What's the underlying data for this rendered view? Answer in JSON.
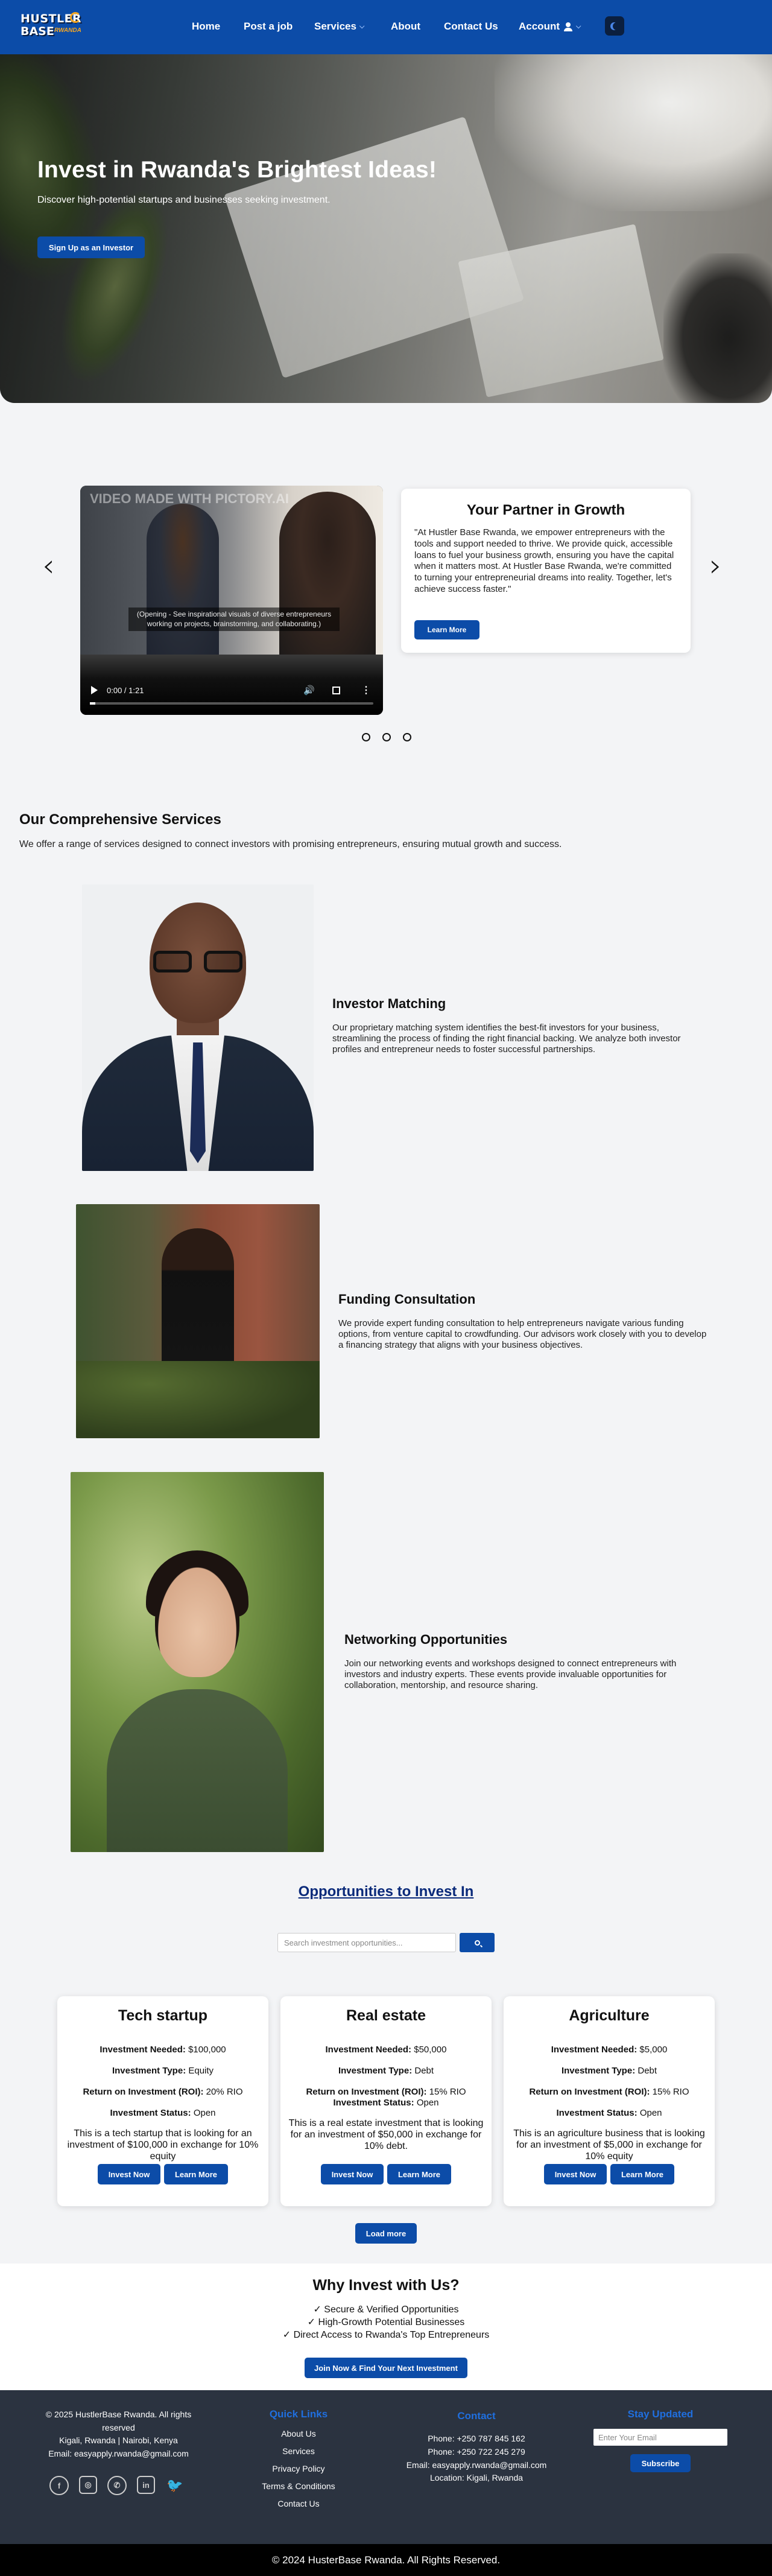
{
  "brand": {
    "logo_line1": "HUSTLER",
    "logo_line2": "BASE",
    "logo_tag": "RWANDA"
  },
  "nav": {
    "home": "Home",
    "post_job": "Post a job",
    "services": "Services",
    "about": "About",
    "contact": "Contact Us",
    "account": "Account"
  },
  "hero": {
    "title": "Invest in Rwanda's Brightest Ideas!",
    "subtitle": "Discover high-potential startups and businesses seeking investment.",
    "cta": "Sign Up as an Investor"
  },
  "video": {
    "watermark": "VIDEO MADE WITH PICTORY.AI",
    "caption": "(Opening - See inspirational visuals of diverse entrepreneurs working on projects, brainstorming, and collaborating.)",
    "time": "0:00 / 1:21",
    "progress": 0.02
  },
  "partner": {
    "title": "Your Partner in Growth",
    "text": "\"At Hustler Base Rwanda, we empower entrepreneurs with the tools and support needed to thrive. We provide quick, accessible loans to fuel your business growth, ensuring you have the capital when it matters most. At Hustler Base Rwanda, we're committed to turning your entrepreneurial dreams into reality. Together, let's achieve success faster.\"",
    "button": "Learn More"
  },
  "services": {
    "title": "Our Comprehensive Services",
    "subtitle": "We offer a range of services designed to connect investors with promising entrepreneurs, ensuring mutual growth and success.",
    "items": [
      {
        "title": "Investor Matching",
        "text": "Our proprietary matching system identifies the best-fit investors for your business, streamlining the process of finding the right financial backing. We analyze both investor profiles and entrepreneur needs to foster successful partnerships."
      },
      {
        "title": "Funding Consultation",
        "text": "We provide expert funding consultation to help entrepreneurs navigate various funding options, from venture capital to crowdfunding. Our advisors work closely with you to develop a financing strategy that aligns with your business objectives."
      },
      {
        "title": "Networking Opportunities",
        "text": "Join our networking events and workshops designed to connect entrepreneurs with investors and industry experts. These events provide invaluable opportunities for collaboration, mentorship, and resource sharing."
      }
    ]
  },
  "opportunities": {
    "title": "Opportunities to Invest In",
    "search_placeholder": "Search investment opportunities...",
    "labels": {
      "needed": "Investment Needed:",
      "type": "Investment Type:",
      "roi": "Return on Investment (ROI):",
      "status": "Investment Status:"
    },
    "invest_btn": "Invest Now",
    "learn_btn": "Learn More",
    "load_more": "Load more",
    "cards": [
      {
        "title": "Tech startup",
        "needed": "$100,000",
        "type": "Equity",
        "roi": "20% RIO",
        "status": "Open",
        "desc": "This is a tech startup that is looking for an investment of $100,000 in exchange for 10% equity"
      },
      {
        "title": "Real estate",
        "needed": "$50,000",
        "type": "Debt",
        "roi": "15% RIO",
        "status": "Open",
        "desc": "This is a real estate investment that is looking for an investment of $50,000 in exchange for 10% debt."
      },
      {
        "title": "Agriculture",
        "needed": "$5,000",
        "type": "Debt",
        "roi": "15% RIO",
        "status": "Open",
        "desc": "This is an agriculture business that is looking for an investment of $5,000 in exchange for 10% equity"
      }
    ]
  },
  "why": {
    "title": "Why Invest with Us?",
    "points": [
      "✓ Secure & Verified Opportunities",
      "✓ High-Growth Potential Businesses",
      "✓ Direct Access to Rwanda's Top Entrepreneurs"
    ],
    "button": "Join Now & Find Your Next Investment"
  },
  "footer": {
    "copyright": "© 2025 HustlerBase Rwanda. All rights reserved",
    "location": "Kigali, Rwanda | Nairobi, Kenya",
    "email": "Email: easyapply.rwanda@gmail.com",
    "quick_title": "Quick Links",
    "quick_links": [
      "About Us",
      "Services",
      "Privacy Policy",
      "Terms & Conditions",
      "Contact Us"
    ],
    "contact_title": "Contact",
    "contact_lines": [
      "Phone: +250 787 845 162",
      "Phone: +250 722 245 279",
      "Email: easyapply.rwanda@gmail.com",
      "Location: Kigali, Rwanda"
    ],
    "news_title": "Stay Updated",
    "news_placeholder": "Enter Your Email",
    "subscribe": "Subscribe",
    "bottom": "© 2024 HusterBase Rwanda. All Rights Reserved."
  }
}
